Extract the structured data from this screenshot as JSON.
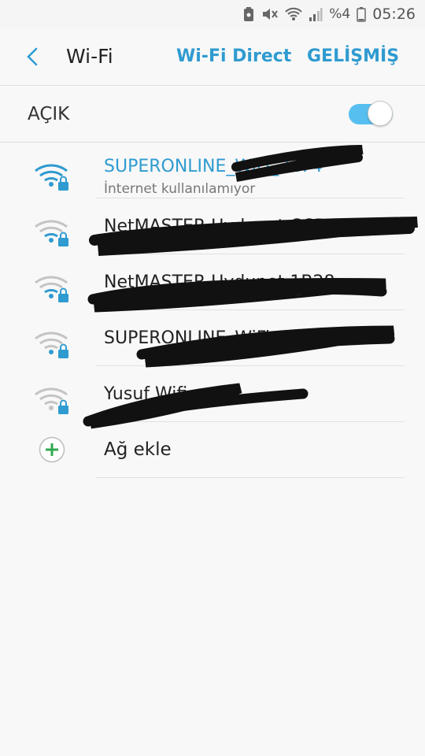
{
  "status_bar": {
    "battery_text": "%4",
    "time": "05:26",
    "icons": [
      "screenshot-icon",
      "mute-icon",
      "wifi-signal-icon",
      "cell-signal-icon",
      "battery-icon"
    ]
  },
  "header": {
    "title": "Wi-Fi",
    "wifi_direct_label": "Wi-Fi Direct",
    "advanced_label": "GELİŞMİŞ"
  },
  "toggle": {
    "label": "AÇIK",
    "on": true
  },
  "networks": [
    {
      "ssid": "SUPERONLINE_WiFi_2274",
      "status": "İnternet kullanılamıyor",
      "connected": true,
      "secured": true
    },
    {
      "ssid": "NetMASTER Uydunet CCBF",
      "status": "",
      "connected": false,
      "secured": true
    },
    {
      "ssid": "NetMASTER Uydunet 1B28",
      "status": "",
      "connected": false,
      "secured": true
    },
    {
      "ssid": "SUPERONLINE_WiFi_7996",
      "status": "",
      "connected": false,
      "secured": true
    },
    {
      "ssid": "Yusuf Wifi a",
      "status": "",
      "connected": false,
      "secured": true
    }
  ],
  "add_network": {
    "label": "Ağ ekle"
  },
  "colors": {
    "accent": "#2f9bd0",
    "toggle_track": "#56bff0",
    "add_icon": "#2fa84f",
    "inactive_wifi": "#b9b9b9"
  }
}
